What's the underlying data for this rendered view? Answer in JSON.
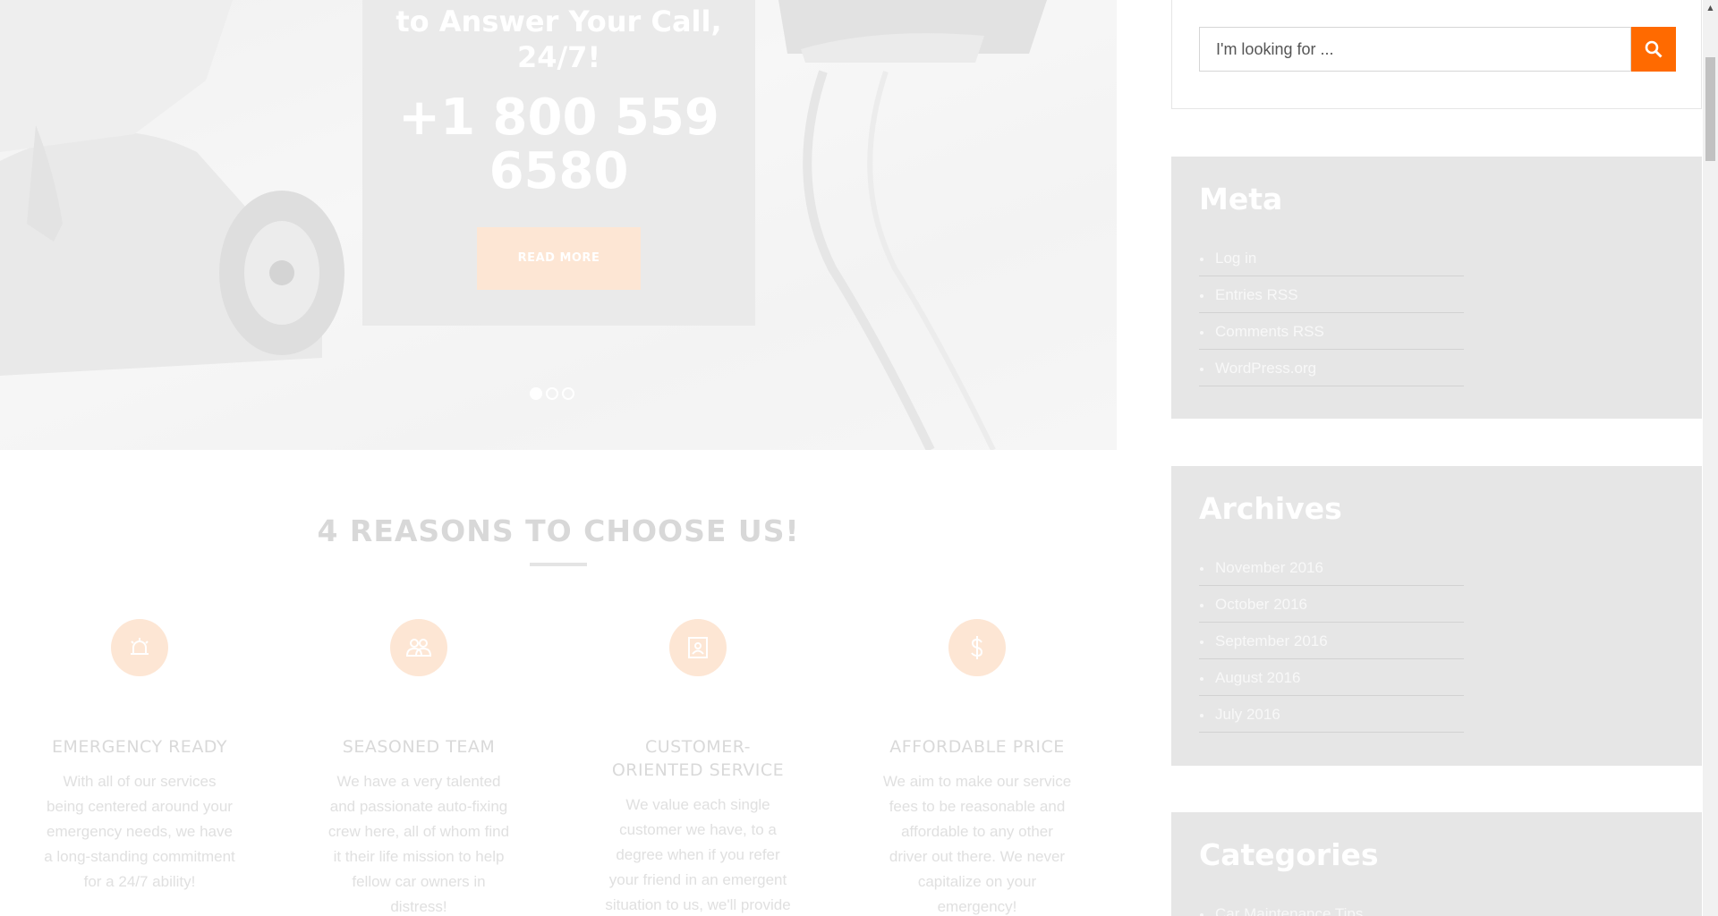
{
  "hero": {
    "heading": "to Answer Your Call, 24/7!",
    "phone": "+1 800 559 6580",
    "button_label": "READ MORE",
    "slides": [
      "1",
      "2",
      "3"
    ],
    "active_slide": 1
  },
  "reasons": {
    "title": "4 REASONS TO CHOOSE US!",
    "items": [
      {
        "icon": "alarm-bell-icon",
        "title": "EMERGENCY READY",
        "text": "With all of our services being centered around your emergency needs, we have a long-standing commitment for a 24/7 ability!"
      },
      {
        "icon": "team-icon",
        "title": "SEASONED TEAM",
        "text": "We have a very talented and passionate auto-fixing crew here, all of whom find it their life mission to help fellow car owners in distress!"
      },
      {
        "icon": "customer-card-icon",
        "title": "CUSTOMER-ORIENTED SERVICE",
        "text": "We value each single customer we have, to a degree when if you refer your friend in an emergent situation to us, we'll provide"
      },
      {
        "icon": "dollar-icon",
        "title": "AFFORDABLE PRICE",
        "text": "We aim to make our service fees to be reasonable and affordable to any other driver out there. We never capitalize on your emergency!"
      }
    ]
  },
  "sidebar": {
    "search": {
      "placeholder": "I'm looking for ..."
    },
    "meta": {
      "title": "Meta",
      "items": [
        "Log in",
        "Entries RSS",
        "Comments RSS",
        "WordPress.org"
      ]
    },
    "archives": {
      "title": "Archives",
      "items": [
        "November 2016",
        "October 2016",
        "September 2016",
        "August 2016",
        "July 2016"
      ]
    },
    "categories": {
      "title": "Categories",
      "items": [
        "Car Maintenance Tips"
      ]
    }
  },
  "colors": {
    "accent": "#ff6a00",
    "accent_faded": "#fde6d4",
    "widget_bg": "#e6e6e6"
  }
}
